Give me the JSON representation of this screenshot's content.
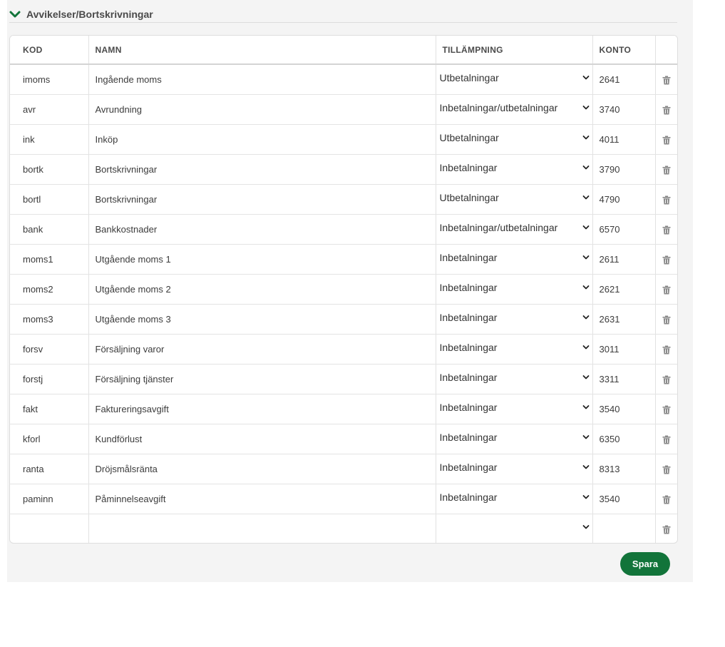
{
  "section": {
    "title": "Avvikelser/Bortskrivningar"
  },
  "table": {
    "headers": [
      "KOD",
      "NAMN",
      "TILLÄMPNING",
      "KONTO",
      ""
    ],
    "rows": [
      {
        "kod": "imoms",
        "namn": "Ingående moms",
        "tillampning": "Utbetalningar",
        "konto": "2641"
      },
      {
        "kod": "avr",
        "namn": "Avrundning",
        "tillampning": "Inbetalningar/utbetalningar",
        "konto": "3740"
      },
      {
        "kod": "ink",
        "namn": "Inköp",
        "tillampning": "Utbetalningar",
        "konto": "4011"
      },
      {
        "kod": "bortk",
        "namn": "Bortskrivningar",
        "tillampning": "Inbetalningar",
        "konto": "3790"
      },
      {
        "kod": "bortl",
        "namn": "Bortskrivningar",
        "tillampning": "Utbetalningar",
        "konto": "4790"
      },
      {
        "kod": "bank",
        "namn": "Bankkostnader",
        "tillampning": "Inbetalningar/utbetalningar",
        "konto": "6570"
      },
      {
        "kod": "moms1",
        "namn": "Utgående moms 1",
        "tillampning": "Inbetalningar",
        "konto": "2611"
      },
      {
        "kod": "moms2",
        "namn": "Utgående moms 2",
        "tillampning": "Inbetalningar",
        "konto": "2621"
      },
      {
        "kod": "moms3",
        "namn": "Utgående moms 3",
        "tillampning": "Inbetalningar",
        "konto": "2631"
      },
      {
        "kod": "forsv",
        "namn": "Försäljning varor",
        "tillampning": "Inbetalningar",
        "konto": "3011"
      },
      {
        "kod": "forstj",
        "namn": "Försäljning tjänster",
        "tillampning": "Inbetalningar",
        "konto": "3311"
      },
      {
        "kod": "fakt",
        "namn": "Faktureringsavgift",
        "tillampning": "Inbetalningar",
        "konto": "3540"
      },
      {
        "kod": "kforl",
        "namn": "Kundförlust",
        "tillampning": "Inbetalningar",
        "konto": "6350"
      },
      {
        "kod": "ranta",
        "namn": "Dröjsmålsränta",
        "tillampning": "Inbetalningar",
        "konto": "8313"
      },
      {
        "kod": "paminn",
        "namn": "Påminnelseavgift",
        "tillampning": "Inbetalningar",
        "konto": "3540"
      },
      {
        "kod": "",
        "namn": "",
        "tillampning": "",
        "konto": ""
      }
    ]
  },
  "footer": {
    "save_label": "Spara"
  },
  "colors": {
    "accent": "#12743a",
    "panel_bg": "#f4f4f4"
  },
  "icons": {
    "section_toggle": "chevron-down-icon",
    "row_delete": "trash-icon",
    "select_arrow": "chevron-down-icon"
  }
}
